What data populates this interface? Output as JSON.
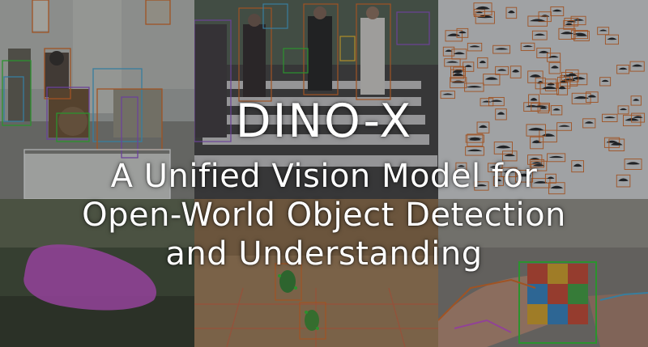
{
  "title": "DINO-X",
  "subtitle_lines": [
    "A Unified Vision Model for",
    "Open-World Object Detection",
    "and Understanding"
  ],
  "colors": {
    "text": "#ffffff",
    "box_orange": "#e8742c",
    "box_green": "#3bd13b",
    "mask_magenta": "#d25ad6",
    "box_purple": "#9a5ad8"
  },
  "panels": [
    "indoor-scene-detections",
    "crosswalk-pedestrian-detections",
    "bird-flock-detections",
    "ground-segmentation-mask",
    "floor-robot-keypoints",
    "hand-pose-cube-detection"
  ]
}
